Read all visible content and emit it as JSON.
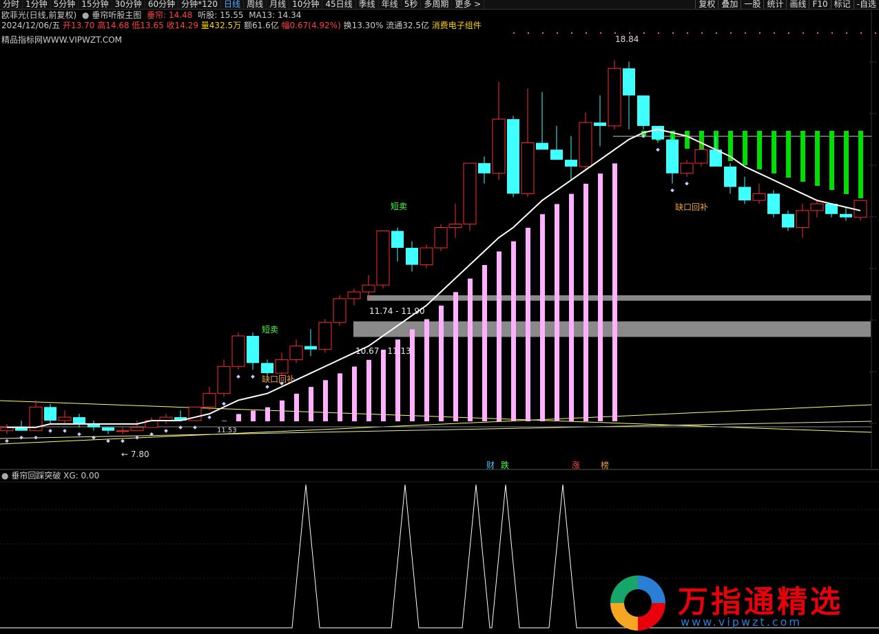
{
  "toolbar": {
    "left": [
      "分时",
      "1分钟",
      "5分钟",
      "15分钟",
      "30分钟",
      "60分钟",
      "分钟*120",
      "日线",
      "周线",
      "月线",
      "10分钟",
      "45日线",
      "季线",
      "年线",
      "5秒",
      "多周期",
      "更多 >"
    ],
    "active": "日线",
    "right": [
      "复权",
      "叠加",
      "一股",
      "统计",
      "画线",
      "F10",
      "标记",
      "-自选"
    ]
  },
  "header": {
    "stock": "欧菲光(日线,前复权)",
    "indicator": "垂帘听股主图",
    "chui_label": "垂帘:",
    "chui_value": "14.48",
    "ting_label": "听股:",
    "ting_value": "15.55",
    "ma_label": "MA13:",
    "ma_value": "14.34"
  },
  "quote": {
    "date": "2024/12/06/五",
    "open": "开13.70",
    "high": "高14.68",
    "low": "低13.65",
    "close": "收14.29",
    "vol": "量432.5万",
    "amount": "额61.6亿",
    "range": "幅0.67(4.92%)",
    "turnover": "换13.30%",
    "float": "流通32.5亿",
    "sector": "消费电子组件"
  },
  "watermark": "精品指标网WWW.VIPWZT.COM",
  "annotations": {
    "high": "18.84",
    "low": "7.80",
    "zone1": "11.74 - 11.90",
    "zone2": "10.67 - 11.13",
    "short_sell_1": "短卖",
    "short_sell_2": "短卖",
    "gap_1": "缺口回补",
    "gap_2": "缺口回补",
    "mini_label": "11.53",
    "badges": [
      "财",
      "跌",
      "涨",
      "榜"
    ]
  },
  "colors": {
    "up": "#ff2b2b",
    "down": "#40ffff",
    "ma": "#ffffff",
    "pink": "#ffb0ff",
    "green": "#00dd00",
    "zone": "#8a8a8a",
    "lines": "#ffff66"
  },
  "sub_panel": {
    "title": "垂帘回踩突破",
    "value": "XG: 0.00"
  },
  "logo": {
    "text": "万指通精选",
    "url": "www.vipwzt.com"
  },
  "chart_data": {
    "type": "candlestick",
    "ohlc": [
      [
        7.9,
        8.1,
        7.8,
        8.0
      ],
      [
        8.0,
        8.2,
        7.9,
        7.9
      ],
      [
        7.9,
        8.8,
        7.9,
        8.6
      ],
      [
        8.6,
        8.7,
        8.1,
        8.2
      ],
      [
        8.2,
        8.5,
        8.1,
        8.3
      ],
      [
        8.3,
        8.4,
        8.0,
        8.1
      ],
      [
        8.1,
        8.2,
        7.9,
        8.0
      ],
      [
        8.0,
        8.0,
        7.8,
        7.9
      ],
      [
        7.9,
        8.0,
        7.8,
        7.9
      ],
      [
        7.9,
        8.2,
        7.9,
        8.0
      ],
      [
        8.0,
        8.3,
        8.0,
        8.2
      ],
      [
        8.2,
        8.4,
        8.1,
        8.3
      ],
      [
        8.3,
        8.5,
        8.2,
        8.2
      ],
      [
        8.2,
        8.6,
        8.2,
        8.6
      ],
      [
        8.6,
        9.2,
        8.5,
        9.0
      ],
      [
        9.0,
        10.0,
        8.9,
        9.8
      ],
      [
        9.8,
        10.8,
        9.7,
        10.7
      ],
      [
        10.7,
        10.8,
        9.7,
        9.9
      ],
      [
        9.9,
        10.0,
        9.4,
        9.6
      ],
      [
        9.6,
        10.2,
        9.5,
        10.0
      ],
      [
        10.0,
        10.6,
        9.9,
        10.4
      ],
      [
        10.4,
        10.9,
        10.1,
        10.3
      ],
      [
        10.3,
        11.2,
        10.2,
        11.1
      ],
      [
        11.1,
        11.9,
        11.0,
        11.8
      ],
      [
        11.8,
        12.1,
        11.6,
        12.0
      ],
      [
        12.0,
        12.5,
        11.8,
        12.2
      ],
      [
        12.2,
        13.8,
        12.1,
        13.8
      ],
      [
        13.8,
        13.9,
        12.9,
        13.3
      ],
      [
        13.3,
        13.5,
        12.6,
        12.8
      ],
      [
        12.8,
        13.4,
        12.7,
        13.3
      ],
      [
        13.3,
        14.0,
        13.2,
        13.9
      ],
      [
        13.9,
        14.6,
        13.6,
        14.0
      ],
      [
        14.0,
        15.8,
        13.8,
        15.8
      ],
      [
        15.8,
        16.0,
        15.2,
        15.5
      ],
      [
        15.5,
        18.2,
        15.3,
        17.1
      ],
      [
        17.1,
        17.2,
        14.8,
        14.9
      ],
      [
        14.9,
        18.0,
        14.8,
        16.4
      ],
      [
        16.4,
        17.9,
        16.2,
        16.2
      ],
      [
        16.2,
        16.9,
        15.9,
        15.9
      ],
      [
        15.9,
        16.6,
        15.3,
        15.7
      ],
      [
        15.7,
        17.3,
        15.6,
        17.0
      ],
      [
        17.0,
        17.8,
        16.3,
        16.9
      ],
      [
        16.9,
        18.84,
        16.8,
        18.6
      ],
      [
        18.6,
        18.8,
        16.8,
        17.8
      ],
      [
        17.8,
        17.8,
        16.8,
        16.9
      ],
      [
        16.9,
        16.9,
        16.4,
        16.5
      ],
      [
        16.5,
        16.6,
        15.2,
        15.5
      ],
      [
        15.5,
        15.9,
        15.4,
        15.8
      ],
      [
        15.8,
        16.5,
        15.7,
        16.2
      ],
      [
        16.2,
        16.6,
        15.7,
        15.7
      ],
      [
        15.7,
        15.8,
        14.9,
        15.1
      ],
      [
        15.1,
        15.4,
        14.6,
        14.7
      ],
      [
        14.7,
        15.2,
        14.6,
        14.9
      ],
      [
        14.9,
        15.0,
        14.2,
        14.3
      ],
      [
        14.3,
        14.4,
        13.8,
        13.9
      ],
      [
        13.9,
        14.6,
        13.6,
        14.4
      ],
      [
        14.4,
        14.7,
        14.2,
        14.6
      ],
      [
        14.6,
        14.6,
        14.2,
        14.3
      ],
      [
        14.3,
        14.5,
        14.1,
        14.2
      ],
      [
        14.2,
        14.7,
        14.1,
        14.7
      ]
    ],
    "ma13": [
      8.0,
      8.0,
      8.0,
      8.1,
      8.1,
      8.1,
      8.1,
      8.1,
      8.1,
      8.1,
      8.2,
      8.2,
      8.2,
      8.3,
      8.4,
      8.6,
      8.8,
      8.9,
      9.0,
      9.2,
      9.4,
      9.6,
      9.8,
      10.0,
      10.2,
      10.4,
      10.7,
      11.0,
      11.3,
      11.6,
      12.0,
      12.4,
      12.8,
      13.2,
      13.6,
      13.9,
      14.3,
      14.7,
      15.0,
      15.3,
      15.6,
      15.9,
      16.2,
      16.5,
      16.7,
      16.8,
      16.7,
      16.6,
      16.4,
      16.2,
      16.0,
      15.7,
      15.5,
      15.3,
      15.1,
      14.9,
      14.7,
      14.6,
      14.5,
      14.4
    ],
    "ylim": [
      7.0,
      19.5
    ],
    "xg_signal": [
      15,
      21,
      25,
      27,
      31
    ]
  }
}
